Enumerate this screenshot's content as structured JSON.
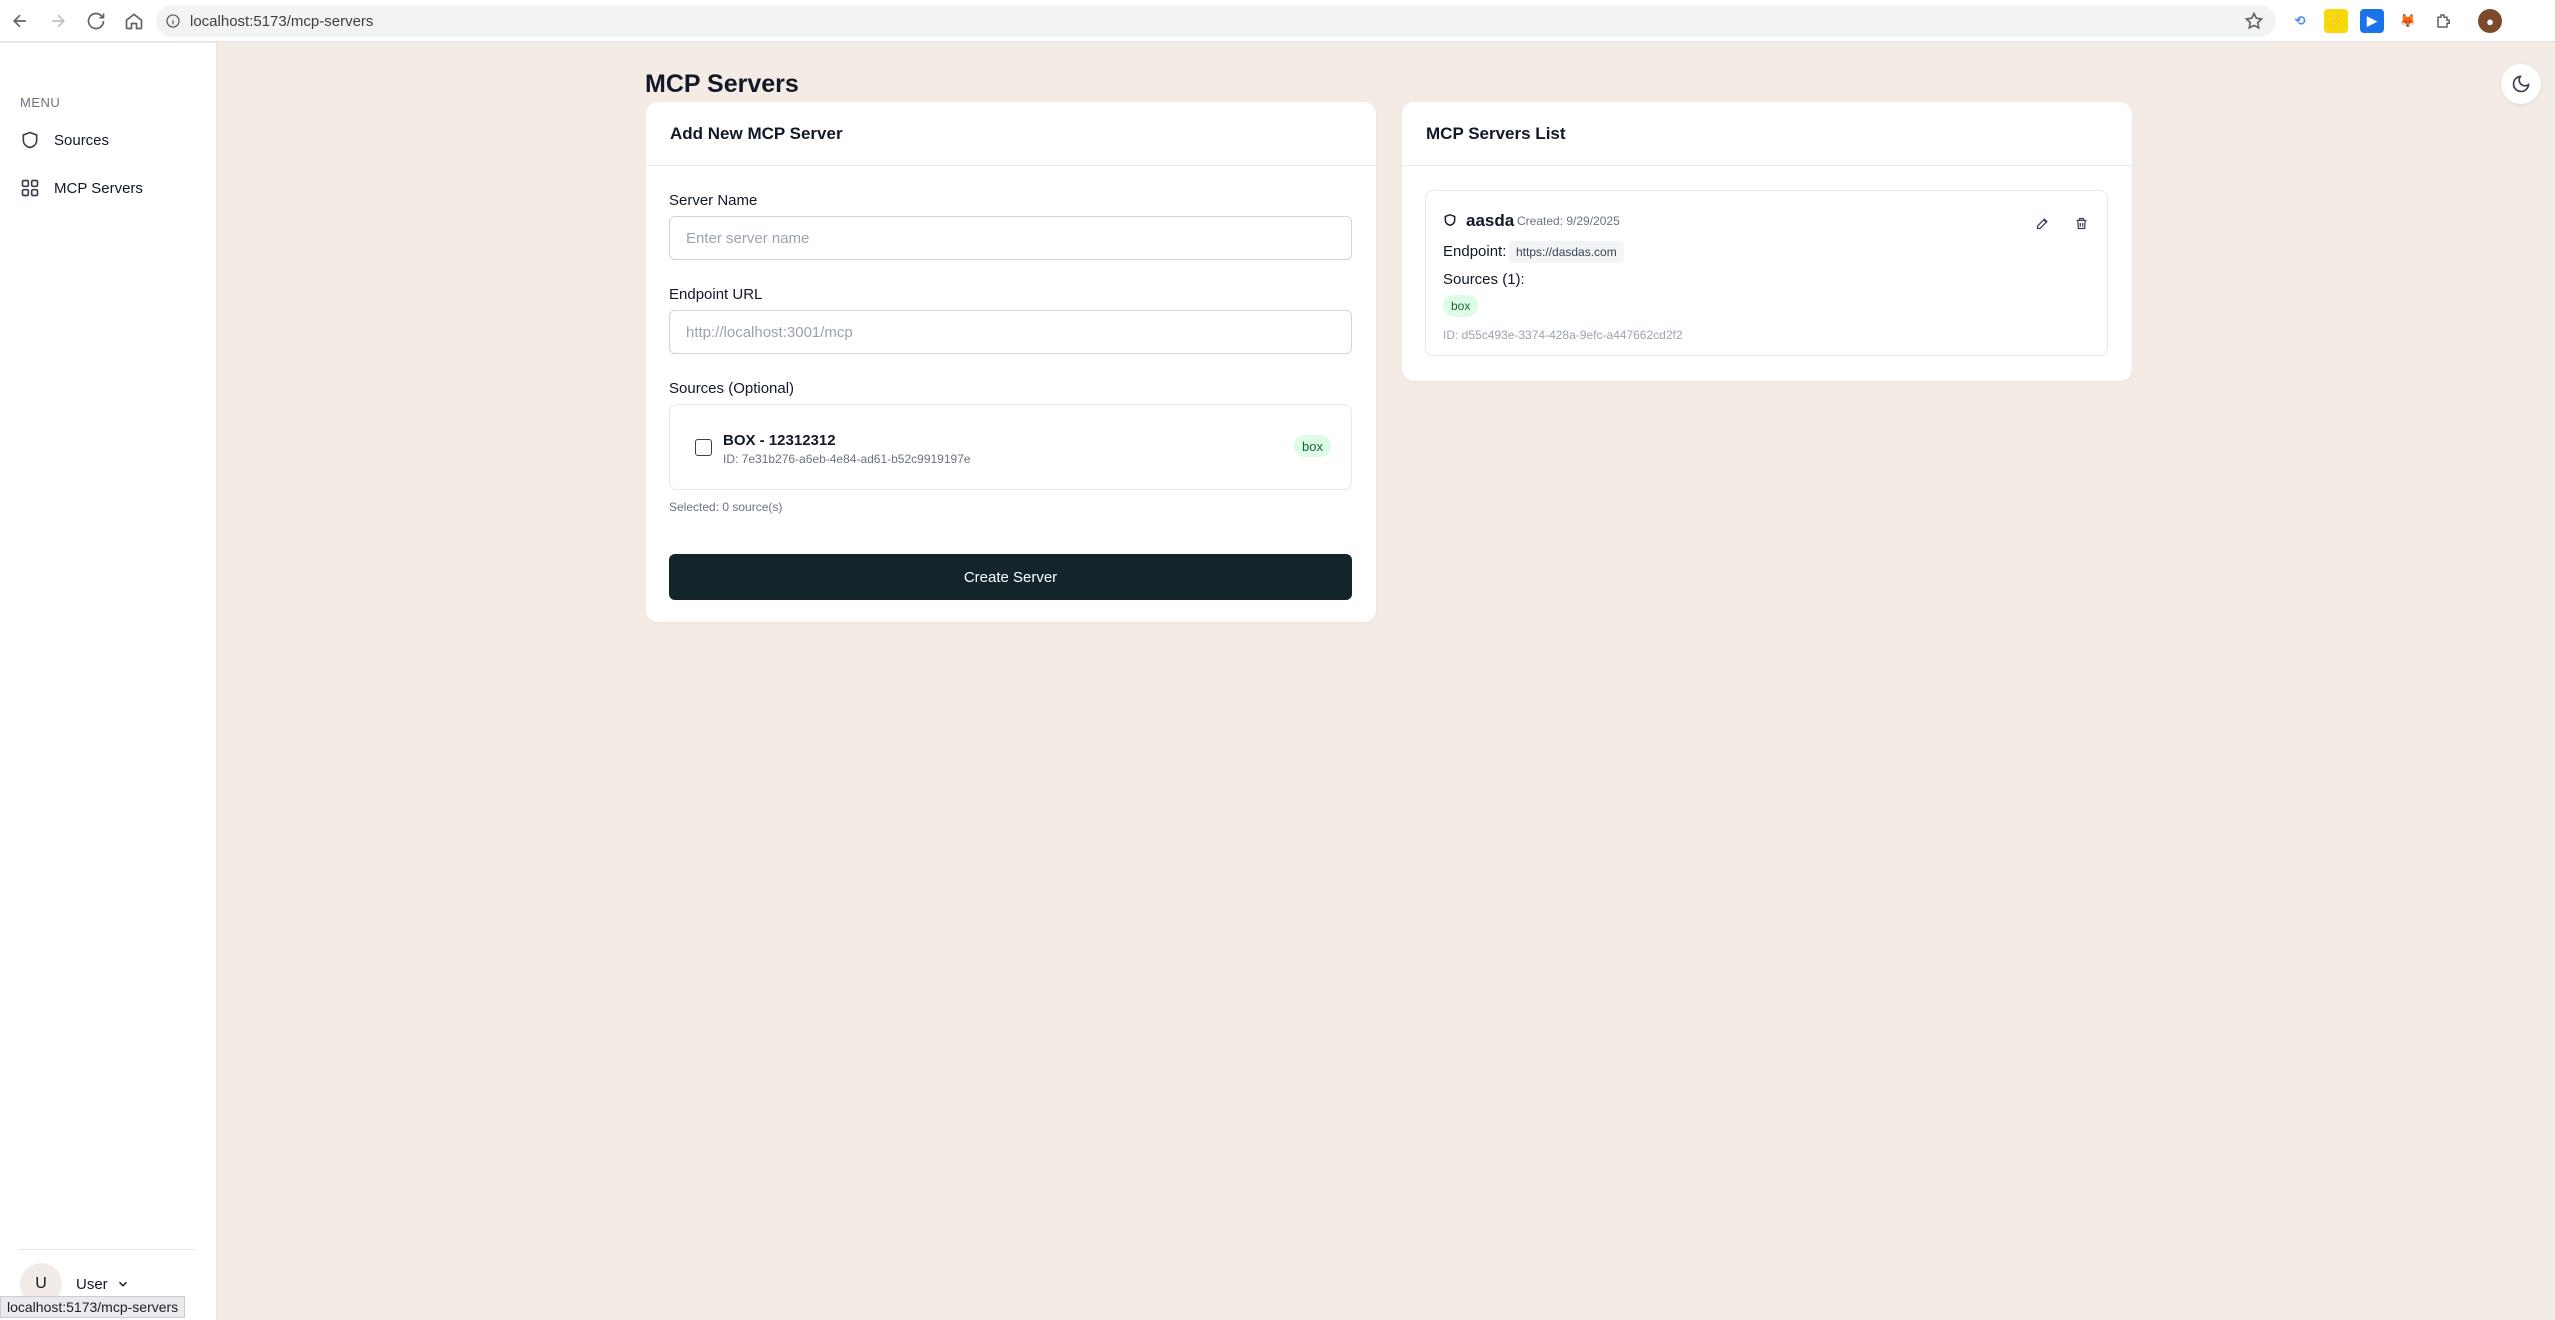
{
  "browser": {
    "url": "localhost:5173/mcp-servers",
    "status_url": "localhost:5173/mcp-servers"
  },
  "sidebar": {
    "menu_label": "MENU",
    "items": [
      {
        "label": "Sources",
        "icon": "shield-icon"
      },
      {
        "label": "MCP Servers",
        "icon": "grid-icon"
      }
    ],
    "user": {
      "initial": "U",
      "name": "User"
    }
  },
  "page": {
    "title": "MCP Servers"
  },
  "add_form": {
    "title": "Add New MCP Server",
    "server_name_label": "Server Name",
    "server_name_placeholder": "Enter server name",
    "server_name_value": "",
    "endpoint_label": "Endpoint URL",
    "endpoint_placeholder": "http://localhost:3001/mcp",
    "endpoint_value": "",
    "sources_label": "Sources (Optional)",
    "sources": [
      {
        "name": "BOX - 12312312",
        "id": "ID: 7e31b276-a6eb-4e84-ad61-b52c9919197e",
        "type": "box",
        "checked": false
      }
    ],
    "selected_text": "Selected: 0 source(s)",
    "submit_label": "Create Server"
  },
  "server_list": {
    "title": "MCP Servers List",
    "servers": [
      {
        "name": "aasda",
        "created": "Created: 9/29/2025",
        "endpoint_label": "Endpoint:",
        "endpoint": "https://dasdas.com",
        "sources_label": "Sources (1):",
        "sources": [
          "box"
        ],
        "id": "ID: d55c493e-3374-428a-9efc-a447662cd2f2"
      }
    ]
  },
  "colors": {
    "background": "#f3ebe4",
    "primary_button": "#13252b",
    "badge_bg": "#dcfce7",
    "badge_text": "#166534"
  }
}
